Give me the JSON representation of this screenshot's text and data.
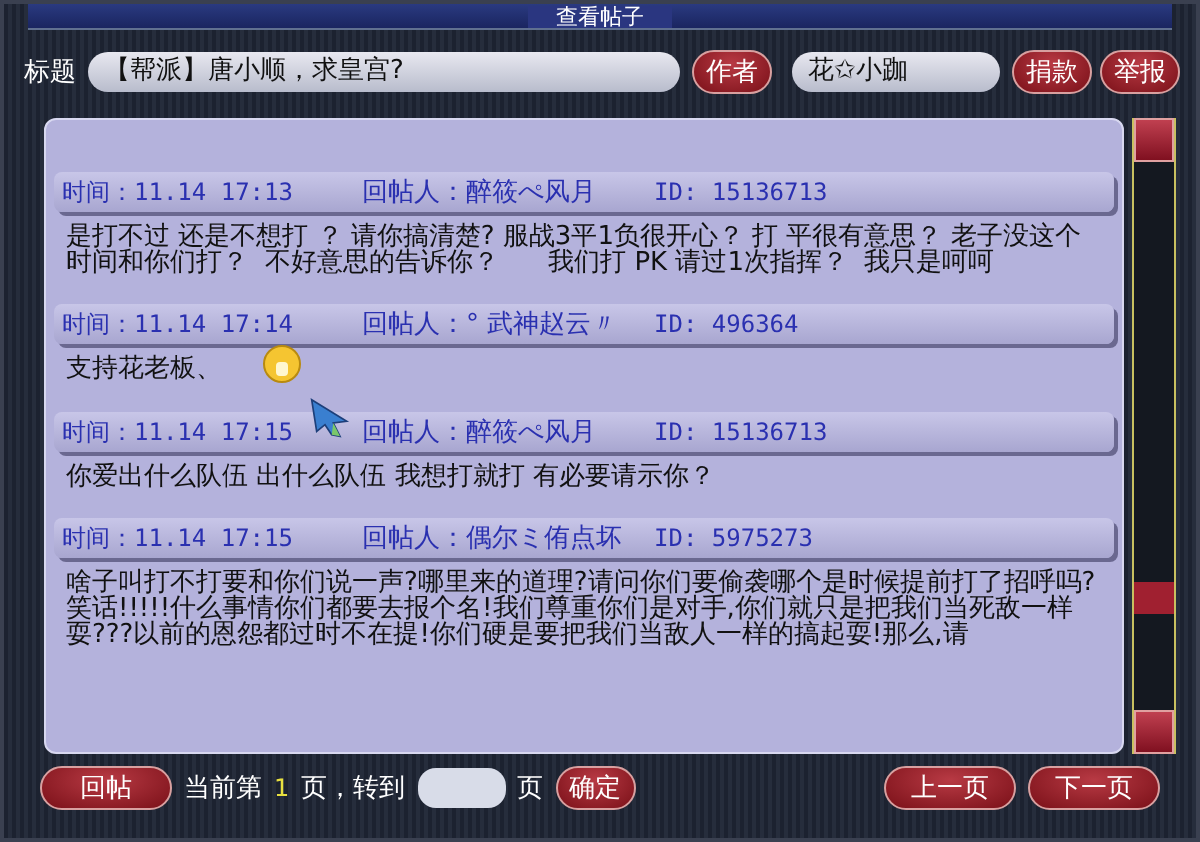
{
  "window": {
    "title": "查看帖子"
  },
  "topic": {
    "label": "标题",
    "title": "【帮派】唐小顺，求皇宫?",
    "author_button": "作者",
    "author": "花✩小跏",
    "buttons": [
      "捐款",
      "举报"
    ]
  },
  "posts": [
    {
      "time": "时间：11.14 17:13",
      "author": "回帖人：醉筱ぺ风月",
      "id": "ID: 15136713",
      "body": "是打不过 还是不想打 ？ 请你搞清楚? 服战3平1负很开心？ 打 平很有意思？ 老子没这个时间和你们打？  不好意思的告诉你？      我们打 PK 请过1次指挥？  我只是呵呵"
    },
    {
      "time": "时间：11.14 17:14",
      "author": "回帖人：° 武神赵云〃",
      "id": "ID: 496364",
      "body": "支持花老板、",
      "emoticon": true
    },
    {
      "time": "时间：11.14 17:15",
      "author": "回帖人：醉筱ぺ风月",
      "id": "ID: 15136713",
      "body": "你爱出什么队伍 出什么队伍 我想打就打 有必要请示你？",
      "cursor": true
    },
    {
      "time": "时间：11.14 17:15",
      "author": "回帖人：偶尔ミ侑点坏",
      "id": "ID: 5975273",
      "body": "啥子叫打不打要和你们说一声?哪里来的道理?请问你们要偷袭哪个是时候提前打了招呼吗?笑话!!!!!什么事情你们都要去报个名!我们尊重你们是对手,你们就只是把我们当死敌一样耍???以前的恩怨都过时不在提!你们硬是要把我们当敌人一样的搞起耍!那么,请"
    }
  ],
  "footer": {
    "reply_button": "回帖",
    "page_prefix": "当前第",
    "page": "1",
    "page_goto": "页，转到",
    "page_suffix": "页",
    "confirm_button": "确定",
    "prev_button": "上一页",
    "next_button": "下一页"
  }
}
